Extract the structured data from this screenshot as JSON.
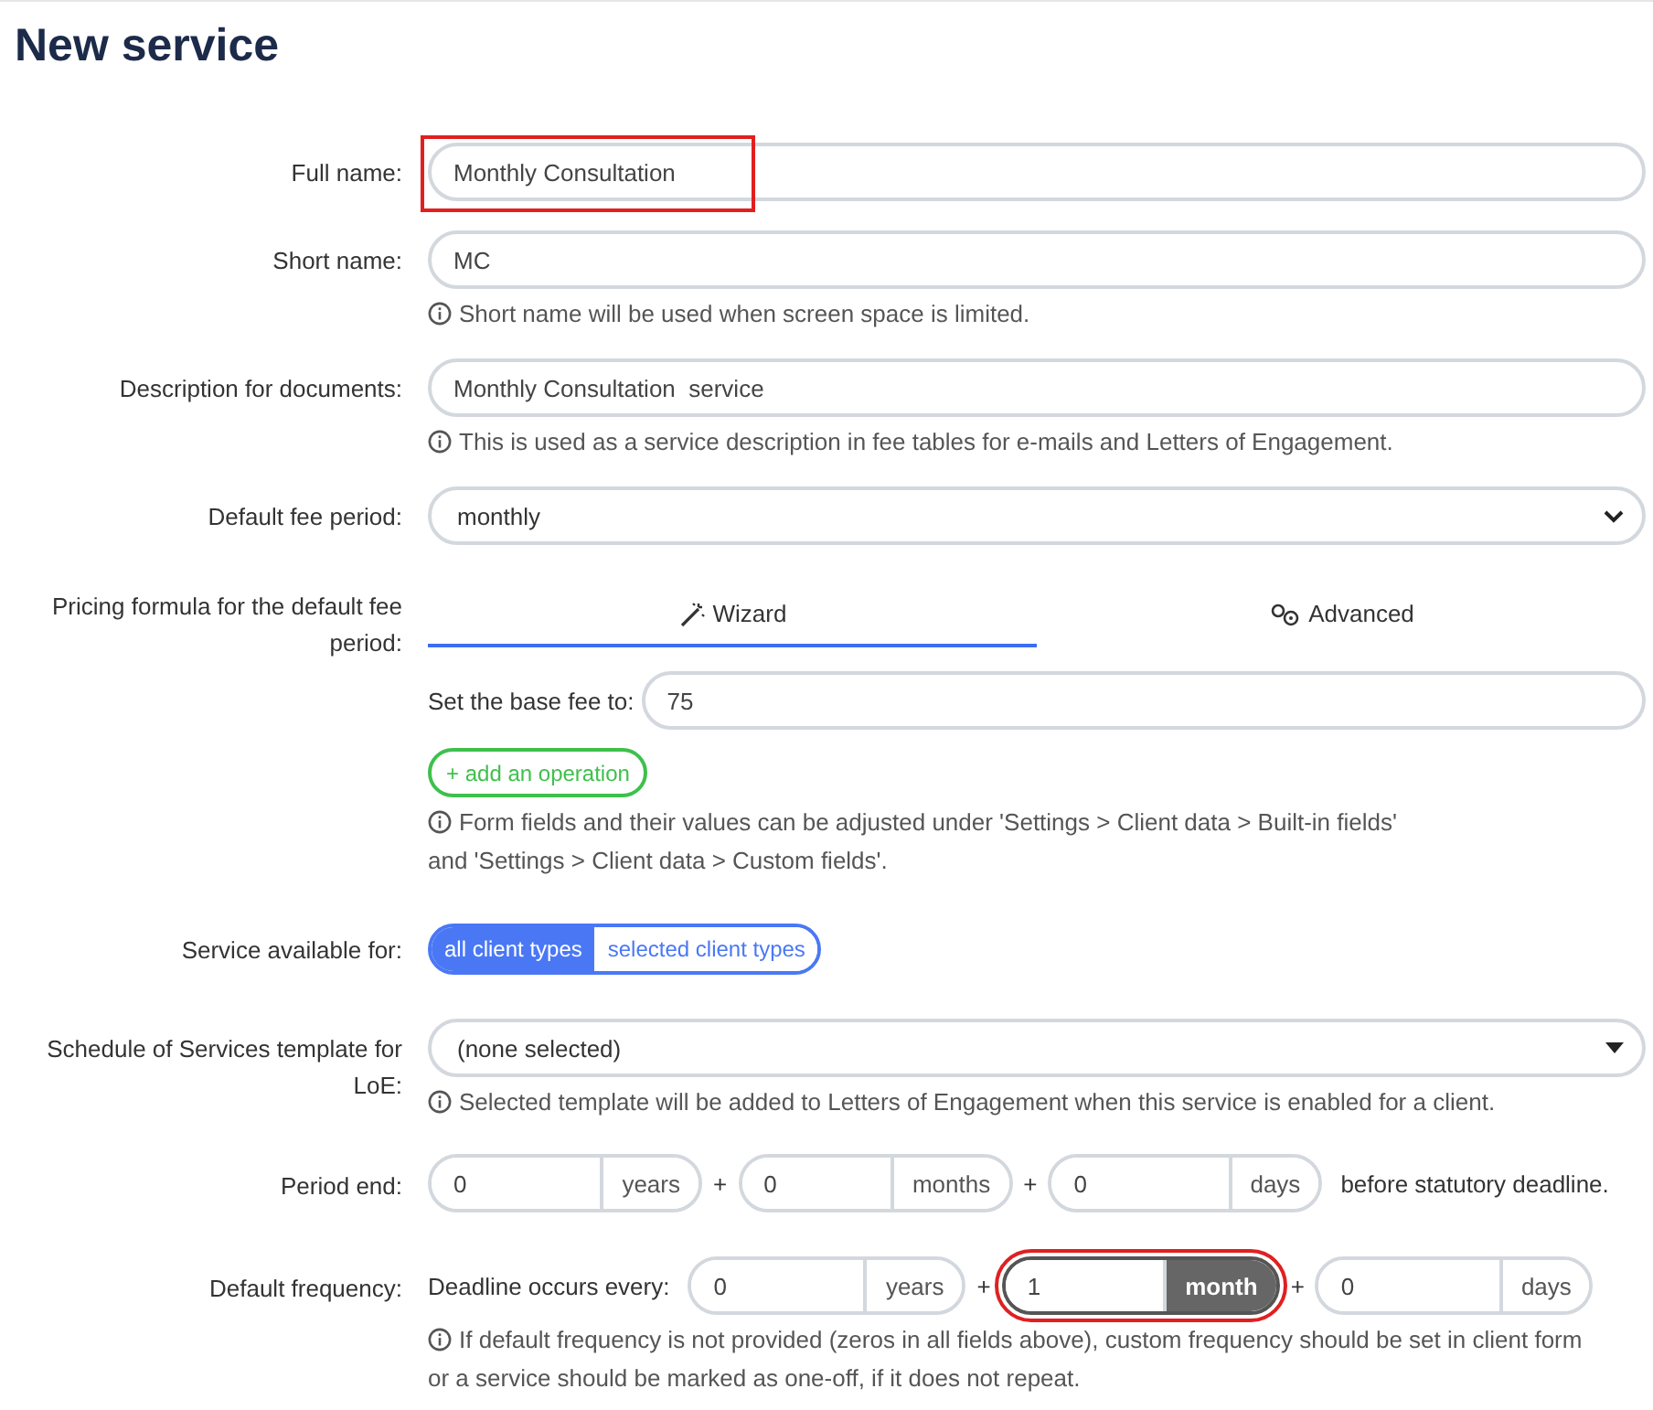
{
  "title": "New service",
  "rows": [
    {
      "kind": "text",
      "label": "Full name:",
      "value": "Monthly Consultation",
      "highlighted": true
    },
    {
      "kind": "text",
      "label": "Short name:",
      "value": "MC",
      "highlighted": false,
      "hint": "Short name will be used when screen space is limited."
    },
    {
      "kind": "text",
      "label": "Description for documents:",
      "value": "Monthly Consultation  service",
      "highlighted": false,
      "hint": "This is used as a service description in fee tables for e-mails and Letters of Engagement."
    },
    {
      "kind": "select",
      "label": "Default fee period:",
      "value": "monthly"
    },
    {
      "kind": "pricing",
      "label": "Pricing formula for the default fee period:",
      "tabs": [
        {
          "label": "Wizard",
          "selected": true
        },
        {
          "label": "Advanced",
          "selected": false
        }
      ],
      "base_label": "Set the base fee to:",
      "base_value": "75",
      "add_icon": "+",
      "add_button": "add an operation",
      "hint_lines": [
        "Form fields and their values can be adjusted under 'Settings > Client data > Built-in fields'",
        "and 'Settings > Client data > Custom fields'."
      ]
    },
    {
      "kind": "toggle",
      "label": "Service available for:",
      "options": [
        {
          "label": "all client types",
          "selected": true
        },
        {
          "label": "selected client types",
          "selected": false
        }
      ]
    },
    {
      "kind": "dropdown",
      "label": "Schedule of Services template for LoE:",
      "value": "(none selected)",
      "hint": "Selected template will be added to Letters of Engagement when this service is enabled for a client."
    },
    {
      "kind": "duration",
      "label": "Period end:",
      "separator": "+",
      "parts": [
        {
          "value": "0",
          "unit": "years",
          "highlighted": false
        },
        {
          "value": "0",
          "unit": "months",
          "highlighted": false
        },
        {
          "value": "0",
          "unit": "days",
          "highlighted": false
        }
      ],
      "suffix": "before statutory deadline."
    },
    {
      "kind": "duration",
      "label": "Default frequency:",
      "prefix": "Deadline occurs every:",
      "separator": "+",
      "parts": [
        {
          "value": "0",
          "unit": "years",
          "highlighted": false
        },
        {
          "value": "1",
          "unit": "month",
          "highlighted": true
        },
        {
          "value": "0",
          "unit": "days",
          "highlighted": false
        }
      ],
      "hint_lines": [
        "If default frequency is not provided (zeros in all fields above), custom frequency should be set in client form",
        "or a service should be marked as one-off, if it does not repeat."
      ]
    }
  ]
}
